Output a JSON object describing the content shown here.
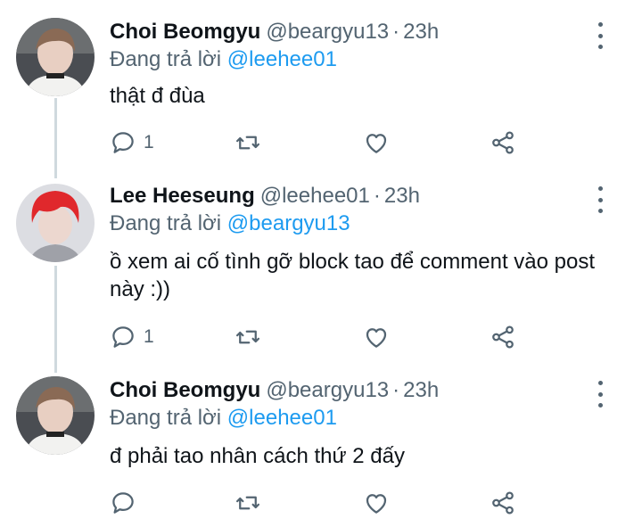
{
  "tweets": [
    {
      "name": "Choi Beomgyu",
      "handle": "@beargyu13",
      "separator": "·",
      "time": "23h",
      "replying_prefix": "Đang trả lời",
      "replying_to": "@leehee01",
      "text": "thật đ đùa",
      "reply_count": "1",
      "avatar_icon": "user-avatar-beomgyu"
    },
    {
      "name": "Lee Heeseung",
      "handle": "@leehee01",
      "separator": "·",
      "time": "23h",
      "replying_prefix": "Đang trả lời",
      "replying_to": "@beargyu13",
      "text": "ồ xem ai cố tình gỡ block tao để comment vào post này :))",
      "reply_count": "1",
      "avatar_icon": "user-avatar-heeseung"
    },
    {
      "name": "Choi Beomgyu",
      "handle": "@beargyu13",
      "separator": "·",
      "time": "23h",
      "replying_prefix": "Đang trả lời",
      "replying_to": "@leehee01",
      "text": "đ phải tao nhân cách thứ 2 đấy",
      "reply_count": "",
      "avatar_icon": "user-avatar-beomgyu"
    }
  ],
  "colors": {
    "accent": "#1d9bf0",
    "secondary_text": "#536471",
    "primary_text": "#0f1419",
    "thread_line": "#cfd9de"
  }
}
